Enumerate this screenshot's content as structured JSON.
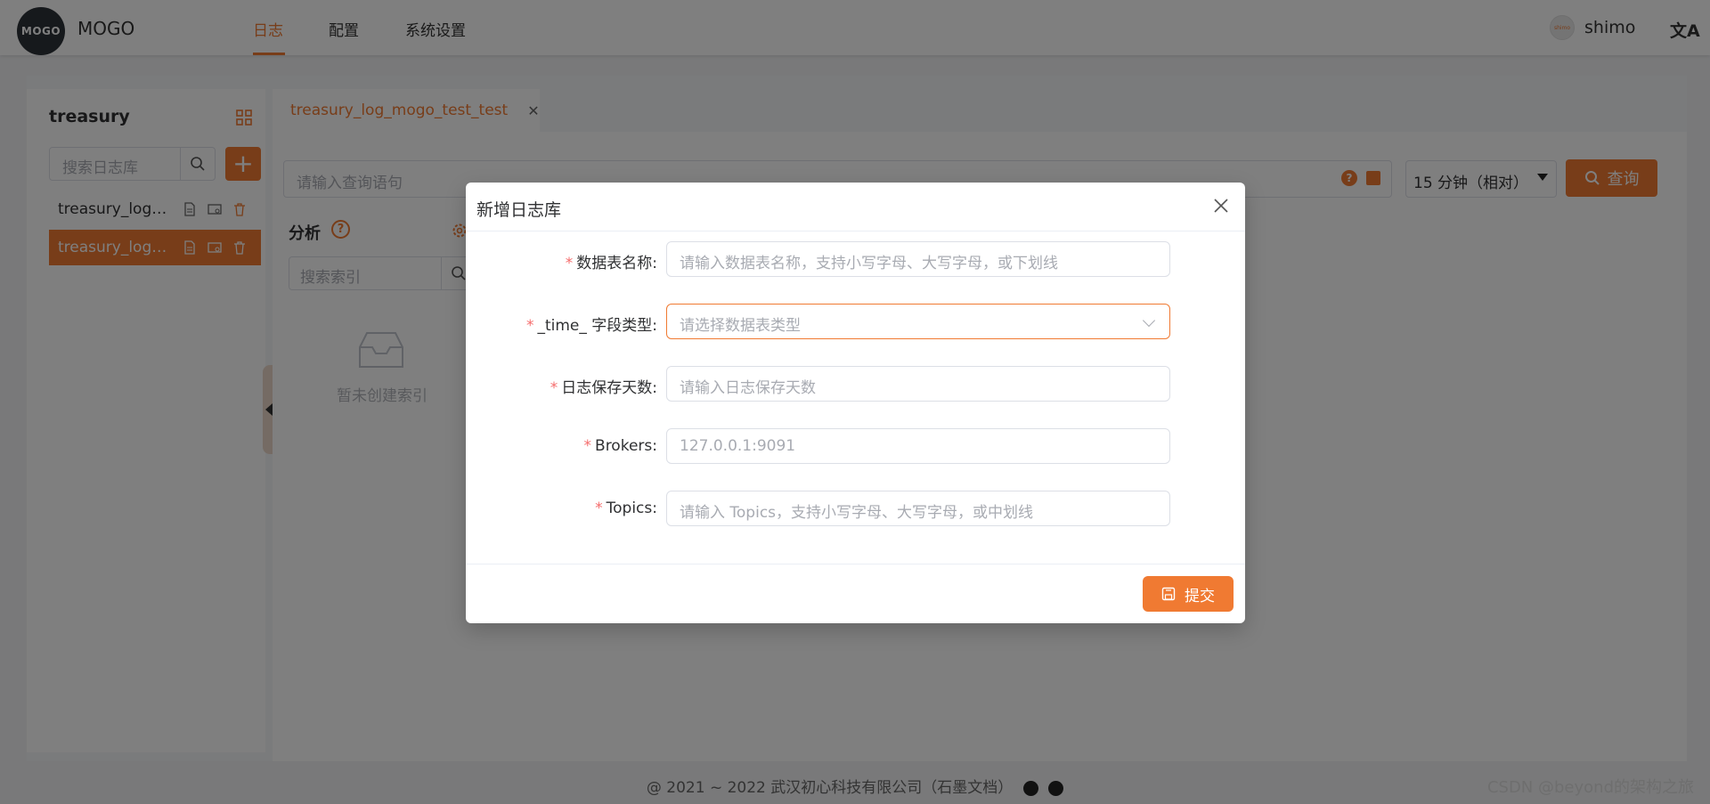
{
  "header": {
    "logo_text": "MOGO",
    "app_name": "MOGO",
    "nav": [
      "日志",
      "配置",
      "系统设置"
    ],
    "user_avatar_text": "shimo",
    "user_name": "shimo",
    "lang_icon": "translate-icon"
  },
  "sidebar": {
    "instance_title": "treasury",
    "search_placeholder": "搜索日志库",
    "items": [
      {
        "label": "treasury_log_mogo_test_test"
      },
      {
        "label": "treasury_log_mogo_test_test"
      }
    ]
  },
  "tab": {
    "label": "treasury_log_mogo_test_test"
  },
  "query": {
    "placeholder": "请输入查询语句",
    "time_range": "15 分钟（相对）",
    "button_label": "查询"
  },
  "analysis": {
    "title": "分析",
    "search_placeholder": "搜索索引",
    "empty_text": "暂未创建索引"
  },
  "footer": {
    "copyright": "@ 2021 ~ 2022 武汉初心科技有限公司（石墨文档）",
    "watermark": "CSDN @beyond的架构之旅"
  },
  "dialog": {
    "title": "新增日志库",
    "fields": [
      {
        "label": "数据表名称",
        "placeholder": "请输入数据表名称，支持小写字母、大写字母，或下划线"
      },
      {
        "label": "_time_ 字段类型",
        "placeholder": "请选择数据表类型"
      },
      {
        "label": "日志保存天数",
        "placeholder": "请输入日志保存天数"
      },
      {
        "label": "Brokers",
        "placeholder": "127.0.0.1:9091"
      },
      {
        "label": "Topics",
        "placeholder": "请输入 Topics，支持小写字母、大写字母，或中划线"
      }
    ],
    "required_mark": "*",
    "label_suffix": ":",
    "submit_label": "提交"
  },
  "colors": {
    "accent": "#f07a32",
    "required": "#f56c6c",
    "overlay": "rgba(0,0,0,0.5)"
  }
}
